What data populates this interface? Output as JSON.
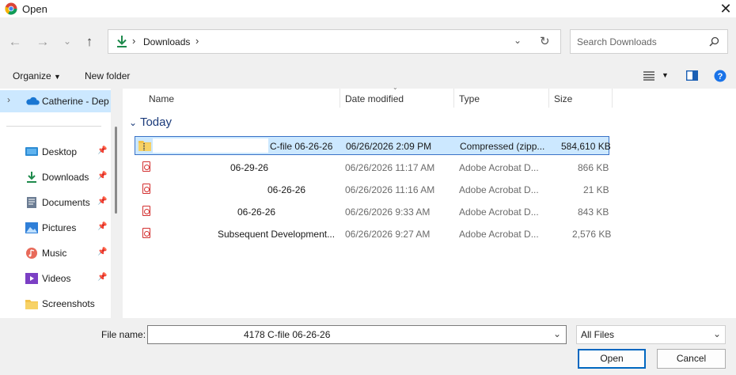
{
  "window": {
    "title": "Open"
  },
  "address": {
    "segments": [
      "Downloads"
    ]
  },
  "search": {
    "placeholder": "Search Downloads"
  },
  "toolbar": {
    "organize_label": "Organize",
    "new_folder_label": "New folder"
  },
  "sidebar": {
    "top_item": "Catherine - Dep",
    "items": [
      {
        "label": "Desktop",
        "icon": "desktop-icon"
      },
      {
        "label": "Downloads",
        "icon": "download-icon"
      },
      {
        "label": "Documents",
        "icon": "documents-icon"
      },
      {
        "label": "Pictures",
        "icon": "pictures-icon"
      },
      {
        "label": "Music",
        "icon": "music-icon"
      },
      {
        "label": "Videos",
        "icon": "videos-icon"
      },
      {
        "label": "Screenshots",
        "icon": "folder-icon"
      }
    ]
  },
  "columns": {
    "name": "Name",
    "date": "Date modified",
    "type": "Type",
    "size": "Size"
  },
  "group": {
    "label": "Today"
  },
  "files": [
    {
      "name": "C-file 06-26-26",
      "date": "06/26/2026 2:09 PM",
      "type": "Compressed (zipp...",
      "size": "584,610 KB",
      "icon": "zip-folder-icon"
    },
    {
      "name": "06-29-26",
      "date": "06/26/2026 11:17 AM",
      "type": "Adobe Acrobat D...",
      "size": "866 KB",
      "icon": "pdf-icon"
    },
    {
      "name": "06-26-26",
      "date": "06/26/2026 11:16 AM",
      "type": "Adobe Acrobat D...",
      "size": "21 KB",
      "icon": "pdf-icon"
    },
    {
      "name": "06-26-26",
      "date": "06/26/2026 9:33 AM",
      "type": "Adobe Acrobat D...",
      "size": "843 KB",
      "icon": "pdf-icon"
    },
    {
      "name": "Subsequent Development...",
      "date": "06/26/2026 9:27 AM",
      "type": "Adobe Acrobat D...",
      "size": "2,576 KB",
      "icon": "pdf-icon"
    }
  ],
  "footer": {
    "filename_label": "File name:",
    "filename_value": "4178 C-file 06-26-26",
    "filter": "All Files",
    "open_label": "Open",
    "cancel_label": "Cancel"
  },
  "colors": {
    "accent": "#0067c0",
    "selection": "#cce8ff",
    "selection_border": "#99d1ff"
  }
}
